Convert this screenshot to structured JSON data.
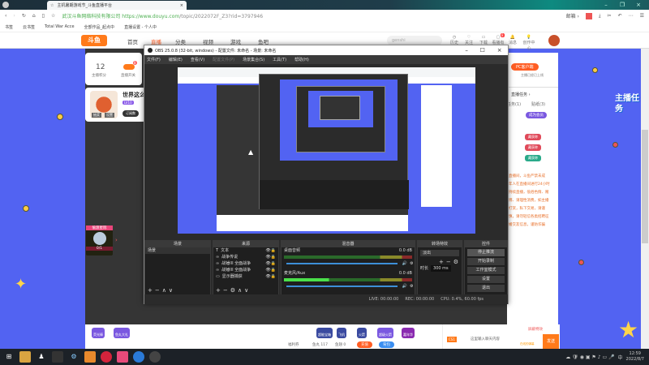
{
  "browser": {
    "tab_title": "主机暑期游戏节_斗鱼直播平台",
    "address_company": "武汉斗鱼网络科技有限公司",
    "url_host": "https://www.douyu.com",
    "url_path": "/topic/2022072F_Z3?rid=3797946",
    "right_link": "邮箱 ›",
    "bookmarks": [
      "书签",
      "云书签",
      "Total War Acce",
      "全部作品_起点中",
      "直播设置 - 个人中"
    ]
  },
  "douyu": {
    "logo": "斗鱼",
    "nav": [
      "首页",
      "直播",
      "分类",
      "视频",
      "游戏",
      "鱼吧"
    ],
    "search_placeholder": "genshi",
    "header_icons": [
      "历史",
      "关注",
      "下载",
      "看播有礼",
      "消息",
      "创作中心"
    ],
    "notif_count": "8",
    "stats": {
      "points": "12",
      "points_label": "主播积分",
      "toggle_label": "直播开关",
      "badge": "8"
    },
    "streamer": {
      "title": "世界这么",
      "tag": "LV10",
      "btn": "订阅数",
      "labels": [
        "抽奖",
        "设置"
      ]
    },
    "event": {
      "title": "偷渡星际",
      "progress": "0/1"
    },
    "pc_client": {
      "button": "PC客户端",
      "note": "主播已经已上线"
    },
    "tasks": {
      "title": "直播任务 ›",
      "tabs": [
        "任务(1)",
        "贴纸(3)"
      ],
      "btn": "成为会员",
      "badges": [
        "藏获称",
        "藏获称",
        "藏获称"
      ]
    },
    "promo": "主播任务",
    "notice": [
      "直播间，斗鱼严禁未成",
      "年人在直播间进行24小时",
      "持续直播，低俗色情、赌",
      "博、请理性消费，如主播",
      "打赏，私下交易，请谨",
      "慎，请勿轻信各类招聘征",
      "婚交友信息，谨防诈骗"
    ],
    "bottom_gifts_left": [
      "荧光棒",
      "鱼丸大礼"
    ],
    "bottom_gifts_right": [
      "超能宝箱",
      "飞机",
      "火箭",
      "超级火箭",
      "嘉年华"
    ],
    "bottom_info": [
      "福利券",
      "鱼丸 117",
      "鱼翅 0"
    ],
    "btn_charge": "充值",
    "btn_bag": "背包",
    "chat": {
      "placeholder": "这里输入聊天内容",
      "send": "发送",
      "barrage": "屏蔽特效",
      "gift_tip": "在线的弹幕",
      "level": "CS1"
    }
  },
  "obs": {
    "title": "OBS 25.0.8 (32-bit, windows) - 配置文件: 未命名 - 场景: 未命名",
    "menu": [
      "文件(F)",
      "编辑(E)",
      "查看(V)",
      "配置文件(P)",
      "场景集合(S)",
      "工具(T)",
      "帮助(H)"
    ],
    "docks": {
      "scenes": "场景",
      "sources": "来源",
      "mixer": "混音器",
      "transitions": "转场特效",
      "controls": "控件"
    },
    "scene_items": [
      "场景"
    ],
    "sources": [
      "文本",
      "战争传说",
      "战锤III 全面战争",
      "战锤III 全面战争",
      "显示器捕获"
    ],
    "mixer": [
      {
        "name": "桌面音频",
        "db": "0.0 dB",
        "level": 0.0
      },
      {
        "name": "麦克风/Aux",
        "db": "0.0 dB",
        "level": 0.35
      }
    ],
    "transition": {
      "type": "淡出",
      "duration_label": "时长",
      "duration": "300 ms"
    },
    "controls": [
      "停止推流",
      "开始录制",
      "工作室模式",
      "设置",
      "退出"
    ],
    "status": {
      "live": "LIVE: 00:00:00",
      "rec": "REC: 00:00:00",
      "cpu": "CPU: 0.4%, 60.00 fps"
    }
  },
  "taskbar": {
    "time": "12:59",
    "date": "2022/8/7",
    "ime": "中"
  }
}
